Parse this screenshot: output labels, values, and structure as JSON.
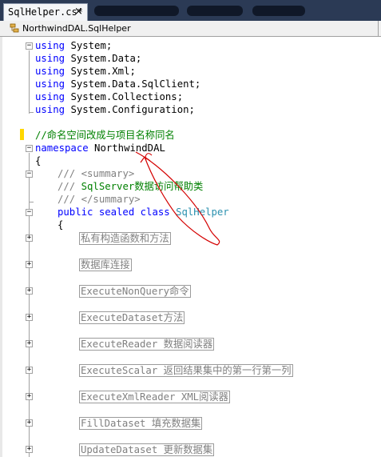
{
  "tabs": {
    "active_label": "SqlHelper.cs*",
    "close_glyph": "×"
  },
  "navbar": {
    "icon": "class-icon",
    "text": "NorthwindDAL.SqlHelper"
  },
  "code": {
    "using_keyword": "using",
    "usings": [
      "System;",
      "System.Data;",
      "System.Xml;",
      "System.Data.SqlClient;",
      "System.Collections;",
      "System.Configuration;"
    ],
    "comment": "//命名空间改成与项目名称同名",
    "namespace_keyword": "namespace",
    "namespace_name": "NorthwindDAL",
    "open_brace": "{",
    "doc_prefix": "///",
    "doc_open_tag": "<summary>",
    "doc_text": "SqlServer数据访问帮助类",
    "doc_close_tag": "</summary>",
    "class_keywords": "public sealed class",
    "class_name": "SqlHelper",
    "inner_brace": "{",
    "regions": [
      "私有构造函数和方法",
      "数据库连接",
      "ExecuteNonQuery命令",
      "ExecuteDataset方法",
      "ExecuteReader 数据阅读器",
      "ExecuteScalar 返回结果集中的第一行第一列",
      "ExecuteXmlReader XML阅读器",
      "FillDataset 填充数据集",
      "UpdateDataset 更新数据集"
    ]
  },
  "colors": {
    "keyword": "#0000ff",
    "comment": "#008000",
    "type": "#2b91af",
    "region_text": "#808080",
    "annotation": "#d40000",
    "modified_marker": "#ffd700"
  }
}
